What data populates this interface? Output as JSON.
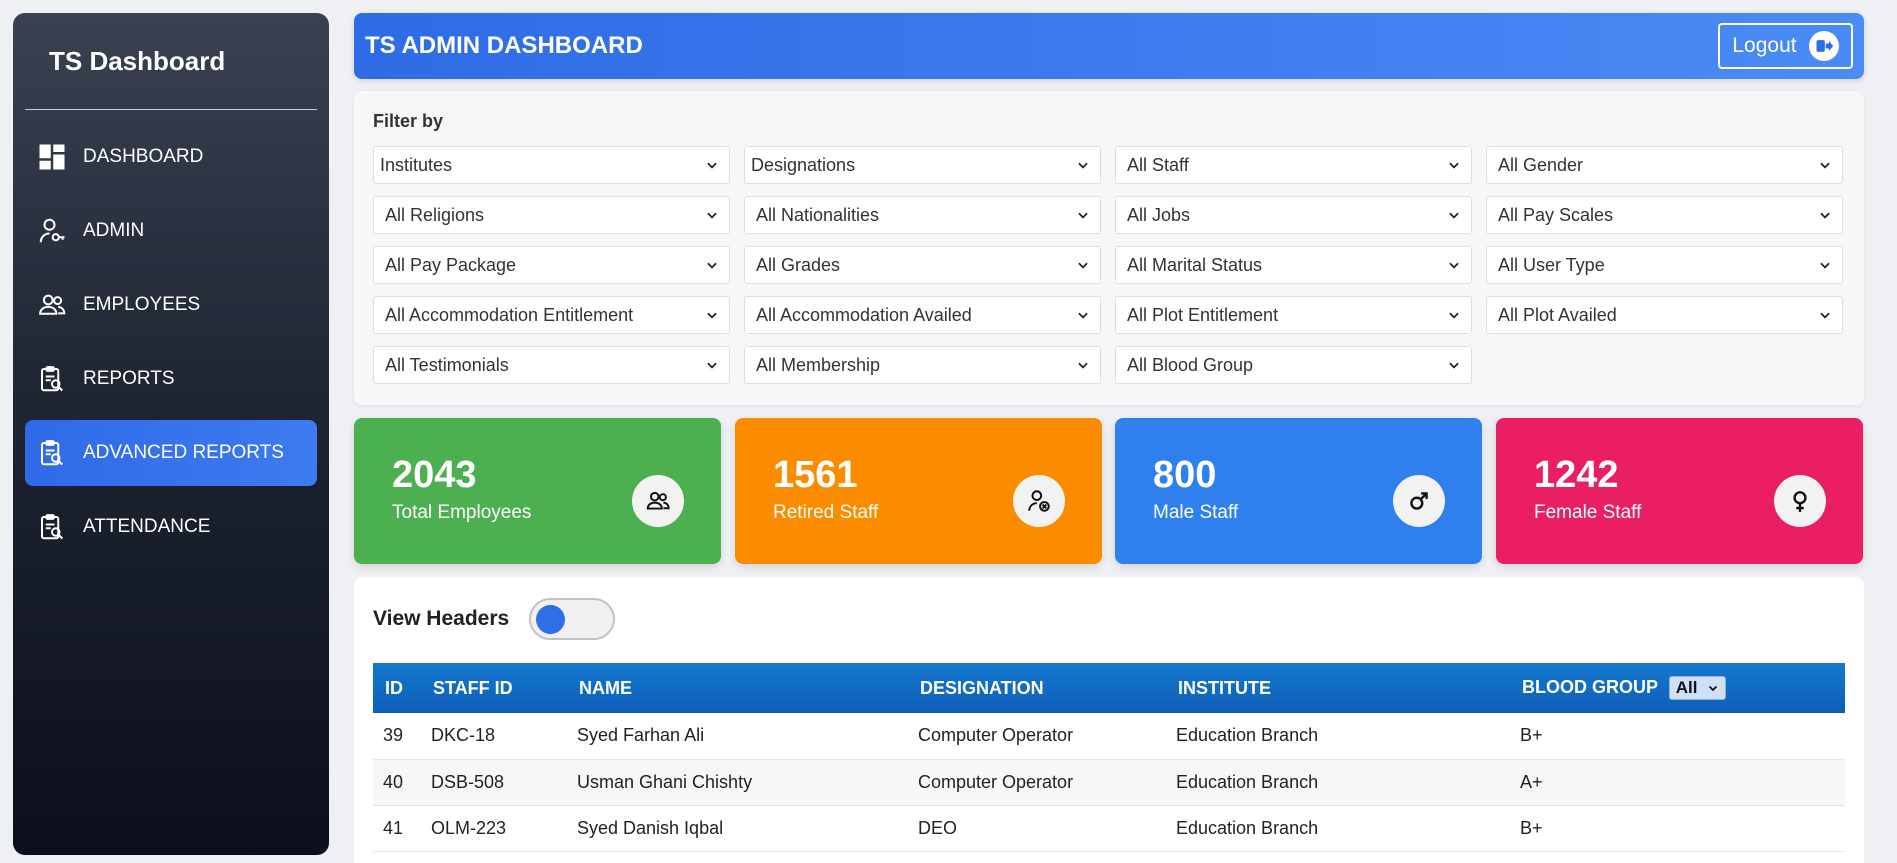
{
  "sidebar": {
    "brand": "TS Dashboard",
    "items": [
      {
        "label": "DASHBOARD",
        "icon": "dashboard-grid-icon",
        "active": false
      },
      {
        "label": "ADMIN",
        "icon": "user-key-icon",
        "active": false
      },
      {
        "label": "EMPLOYEES",
        "icon": "users-icon",
        "active": false
      },
      {
        "label": "REPORTS",
        "icon": "clipboard-search-icon",
        "active": false
      },
      {
        "label": "ADVANCED REPORTS",
        "icon": "clipboard-search-icon",
        "active": true
      },
      {
        "label": "ATTENDANCE",
        "icon": "clipboard-search-icon",
        "active": false
      }
    ]
  },
  "header": {
    "title": "TS ADMIN DASHBOARD",
    "logout_label": "Logout"
  },
  "filters": {
    "label": "Filter by",
    "selects": [
      "Institutes",
      "Designations",
      "All Staff",
      "All Gender",
      "All Religions",
      "All Nationalities",
      "All Jobs",
      "All Pay Scales",
      "All Pay Package",
      "All Grades",
      "All Marital Status",
      "All User Type",
      "All Accommodation Entitlement",
      "All Accommodation Availed",
      "All Plot Entitlement",
      "All Plot Availed",
      "All Testimonials",
      "All Membership",
      "All Blood Group"
    ]
  },
  "stats": [
    {
      "value": "2043",
      "label": "Total Employees",
      "color": "#4caf50",
      "icon": "users-icon"
    },
    {
      "value": "1561",
      "label": "Retired Staff",
      "color": "#fb8c00",
      "icon": "user-remove-icon"
    },
    {
      "value": "800",
      "label": "Male Staff",
      "color": "#2f80ed",
      "icon": "male-icon"
    },
    {
      "value": "1242",
      "label": "Female Staff",
      "color": "#e91e63",
      "icon": "female-icon"
    }
  ],
  "table": {
    "view_headers_label": "View Headers",
    "view_headers_on": false,
    "columns": [
      "ID",
      "STAFF ID",
      "NAME",
      "DESIGNATION",
      "INSTITUTE",
      "BLOOD GROUP"
    ],
    "blood_group_filter": "All",
    "rows": [
      [
        "39",
        "DKC-18",
        "Syed Farhan Ali",
        "Computer Operator",
        "Education Branch",
        "B+"
      ],
      [
        "40",
        "DSB-508",
        "Usman Ghani Chishty",
        "Computer Operator",
        "Education Branch",
        "A+"
      ],
      [
        "41",
        "OLM-223",
        "Syed Danish Iqbal",
        "DEO",
        "Education Branch",
        "B+"
      ]
    ]
  },
  "colors": {
    "header_gradient": [
      "#2e6be6",
      "#4a8bf5"
    ],
    "active_nav": "#2f6ae8",
    "table_header": "#1479cf"
  }
}
